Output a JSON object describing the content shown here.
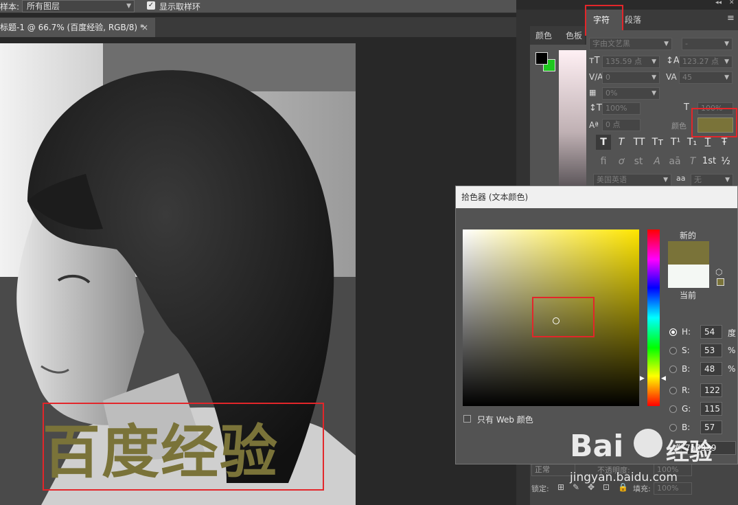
{
  "options_bar": {
    "sample_label": "样本:",
    "sample_value": "所有图层",
    "show_ring_label": "显示取样环",
    "show_ring_checked": true
  },
  "document": {
    "tab_title": "标题-1 @ 66.7% (百度经验, RGB/8) *",
    "close_glyph": "×",
    "canvas_text": "百度经验",
    "text_color": "#7a7339"
  },
  "panels": {
    "color_tab": "颜色",
    "swatch_tab": "色板",
    "character_tab": "字符",
    "paragraph_tab": "段落",
    "menu_glyph": "≡",
    "collapse_glyph": "◂◂",
    "close_glyph": "✕",
    "foreground_color": "#000000",
    "background_color": "#1ec81e"
  },
  "character": {
    "font_family": "字由文艺黑",
    "font_style": "-",
    "font_size": "135.59 点",
    "leading": "123.27 点",
    "kerning": "0",
    "tracking": "45",
    "tsume": "0%",
    "vertical_scale": "100%",
    "horizontal_scale": "100%",
    "baseline_shift": "0 点",
    "color_label": "颜色",
    "color_swatch": "#7a7339",
    "language": "美国英语",
    "aa_icon_text": "aa",
    "antialias": "无",
    "style_buttons": [
      "T",
      "T",
      "TT",
      "Tт",
      "T¹",
      "T₁",
      "T",
      "Ŧ"
    ],
    "opentype_buttons": [
      "fi",
      "ơ",
      "st",
      "A",
      "aā",
      "T",
      "1st",
      "½"
    ]
  },
  "layers_hint": {
    "blend_mode": "正常",
    "opacity_label": "不透明度:",
    "opacity_value": "100%",
    "lock_label": "锁定:",
    "fill_label": "填充:",
    "fill_value": "100%"
  },
  "picker": {
    "title": "拾色器 (文本颜色)",
    "new_label": "新的",
    "current_label": "当前",
    "new_color": "#7a7339",
    "current_color": "#f4f8f4",
    "hue_color": "#ffe600",
    "web_colors_label": "只有 Web 颜色",
    "fields": [
      {
        "label": "H:",
        "value": "54",
        "unit": "度",
        "selected": true
      },
      {
        "label": "S:",
        "value": "53",
        "unit": "%",
        "selected": false
      },
      {
        "label": "B:",
        "value": "48",
        "unit": "%",
        "selected": false
      },
      {
        "label": "R:",
        "value": "122",
        "unit": "",
        "selected": false
      },
      {
        "label": "G:",
        "value": "115",
        "unit": "",
        "selected": false
      },
      {
        "label": "B:",
        "value": "57",
        "unit": "",
        "selected": false
      }
    ],
    "hex_label": "#",
    "hex_value": "7a7339",
    "saturation": 0.53,
    "brightness": 0.48,
    "hue_deg": 54
  },
  "watermark": {
    "brand": "Bai",
    "brand_cn": "经验",
    "url": "jingyan.baidu.com"
  }
}
